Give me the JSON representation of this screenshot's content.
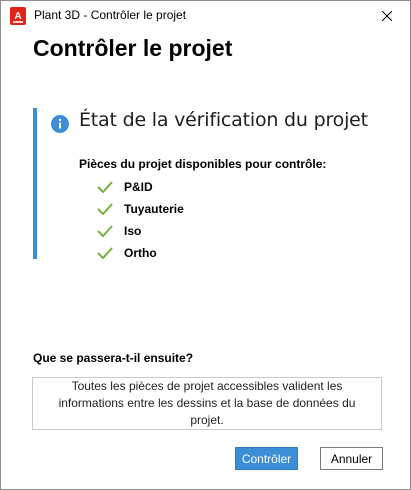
{
  "window": {
    "title": "Plant 3D - Contrôler le projet",
    "app_icon_letter": "A",
    "close_icon": "close-icon"
  },
  "page": {
    "heading": "Contrôler le projet"
  },
  "status": {
    "icon": "info-icon",
    "title": "État de la vérification du projet",
    "available_label": "Pièces du projet disponibles pour contrôle:",
    "parts": [
      {
        "label": "P&ID",
        "icon": "check-icon"
      },
      {
        "label": "Tuyauterie",
        "icon": "check-icon"
      },
      {
        "label": "Iso",
        "icon": "check-icon"
      },
      {
        "label": "Ortho",
        "icon": "check-icon"
      }
    ]
  },
  "next_step": {
    "label": "Que se passera-t-il ensuite?",
    "description": "Toutes les pièces de projet accessibles valident les informations entre les dessins et la base de données du projet."
  },
  "buttons": {
    "primary": "Contrôler",
    "secondary": "Annuler"
  },
  "colors": {
    "accent": "#3c8fd6",
    "check": "#74b13f",
    "app_icon": "#e2231a"
  }
}
